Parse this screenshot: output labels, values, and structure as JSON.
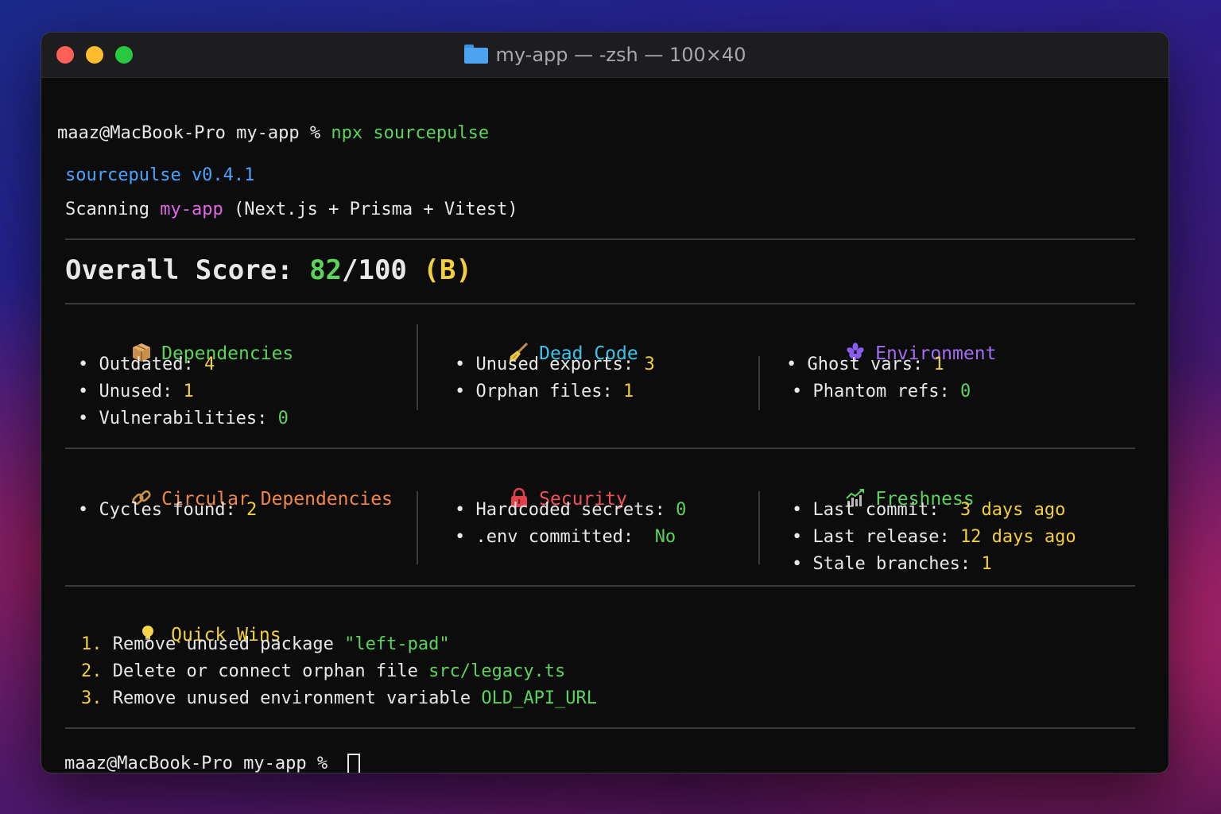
{
  "window": {
    "title": "my-app — -zsh — 100×40"
  },
  "prompt": {
    "user_host": "maaz@MacBook-Pro",
    "dir": "my-app",
    "symbol": "%",
    "command": "npx sourcepulse"
  },
  "tool": {
    "name_version": "sourcepulse v0.4.1",
    "scanning_label": "Scanning",
    "project": "my-app",
    "stack": "(Next.js + Prisma + Vitest)"
  },
  "overall": {
    "label": "Overall Score:",
    "score": "82",
    "max": "/100",
    "grade": "(B)"
  },
  "sections": {
    "dependencies": {
      "title": "Dependencies",
      "items": [
        {
          "label": "Outdated:",
          "value": "4"
        },
        {
          "label": "Unused:",
          "value": "1"
        },
        {
          "label": "Vulnerabilities:",
          "value": "0"
        }
      ]
    },
    "dead_code": {
      "title": "Dead Code",
      "items": [
        {
          "label": "Unused exports:",
          "value": "3"
        },
        {
          "label": "Orphan files:",
          "value": "1"
        }
      ]
    },
    "environment": {
      "title": "Environment",
      "items": [
        {
          "label": "Ghost vars:",
          "value": "1"
        },
        {
          "label": "Phantom refs:",
          "value": "0"
        }
      ]
    },
    "circular": {
      "title": "Circular Dependencies",
      "items": [
        {
          "label": "Cycles found:",
          "value": "2"
        }
      ]
    },
    "security": {
      "title": "Security",
      "items": [
        {
          "label": "Hardcoded secrets:",
          "value": "0"
        },
        {
          "label": ".env committed:",
          "value": "No"
        }
      ]
    },
    "freshness": {
      "title": "Freshness",
      "items": [
        {
          "label": "Last commit:",
          "value": "3 days ago"
        },
        {
          "label": "Last release:",
          "value": "12 days ago"
        },
        {
          "label": "Stale branches:",
          "value": "1"
        }
      ]
    }
  },
  "quick_wins": {
    "title": "Quick Wins",
    "items": [
      {
        "num": "1.",
        "text": "Remove unused package",
        "target": "\"left-pad\""
      },
      {
        "num": "2.",
        "text": "Delete or connect orphan file",
        "target": "src/legacy.ts"
      },
      {
        "num": "3.",
        "text": "Remove unused environment variable",
        "target": "OLD_API_URL"
      }
    ]
  },
  "icons": {
    "dependencies": "package-icon",
    "dead_code": "broom-icon",
    "environment": "flower-icon",
    "circular": "link-icon",
    "security": "lock-icon",
    "freshness": "chart-up-icon",
    "quick_wins": "lightbulb-icon"
  },
  "colors": {
    "green": "#5cd35b",
    "blue": "#4aa3ff",
    "magenta": "#e065e8",
    "yellow": "#f2cf3c",
    "cyan": "#3bc5e8",
    "purple": "#a46cf2",
    "orange": "#f0874a",
    "red": "#f0505a"
  }
}
